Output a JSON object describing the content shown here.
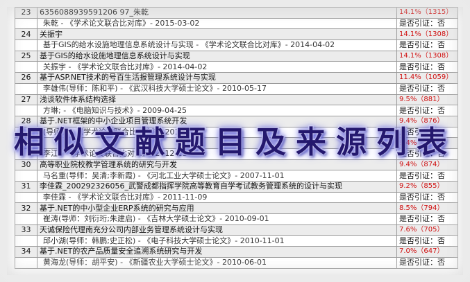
{
  "banner": {
    "text": "相似文献题目及来源列表"
  },
  "rows": [
    {
      "num": "23",
      "title": "6356088939591206 97_朱乾",
      "similarity": "14.1%（1315）",
      "source": "朱乾 - 《学术论文联合比对库》- 2015-03-02",
      "cite": "是否引证：否"
    },
    {
      "num": "24",
      "title": "关振宇",
      "similarity": "14.1%（1308）",
      "source": "基于GIS的给水设施地理信息系统设计与实现 - 《学术论文联合比对库》- 2014-04-02",
      "cite": "是否引证：否"
    },
    {
      "num": "25",
      "title": "基于GIS的给水设施地理信息系统设计与实现",
      "similarity": "14.1%（1308）",
      "source": "关振宇 - 《学术论文联合比对库》- 2014-04-02",
      "cite": "是否引证：否"
    },
    {
      "num": "26",
      "title": "基于ASP.NET技术的号百生活报管理系统设计与实现",
      "similarity": "11.4%（1059）",
      "source": "李雄伟(导师：陈和平) - 《武汉科技大学硕士论文》- 2010-05-17",
      "cite": "是否引证：否"
    },
    {
      "num": "27",
      "title": "浅谈软件体系结构选择",
      "similarity": "9.5%（881）",
      "source": "方琳; - 《电脑知识与技术》- 2009-04-25",
      "cite": "是否引证：否"
    },
    {
      "num": "28",
      "title": "基于.NET框架的中小企业项目管理系统开发",
      "similarity": "9.4%（876）",
      "source": "(导师：) - 《学术论文联合比对库》- 2015-",
      "cite": "是否引证：否"
    },
    {
      "num": "29",
      "title": "",
      "similarity": "9.4%（876）",
      "source": "李江 - 《学术论文联合比对库》- 2012-11-12",
      "cite": "是否引证：否"
    },
    {
      "num": "30",
      "title": "高等职业院校教学管理系统的研究与开发",
      "similarity": "9.4%（874）",
      "source": "马名重(导师：吴清;李新霞) - 《河北工业大学硕士论文》- 2007-11-01",
      "cite": "是否引证：否"
    },
    {
      "num": "31",
      "title": "李佳霖_200292326056_武警成都指挥学院高等教育自学考试教务管理系统的设计与实现",
      "similarity": "9.2%（855）",
      "source": "李佳霖 - 《学术论文联合比对库》- 2011-11-09",
      "cite": "是否引证：否"
    },
    {
      "num": "32",
      "title": "基于.NET的中小型企业ERP系统的研究与应用",
      "similarity": "8.5%（794）",
      "source": "崔涛(导师：刘衍珩;朱建启) - 《吉林大学硕士论文》- 2010-09-01",
      "cite": "是否引证：否"
    },
    {
      "num": "33",
      "title": "天诚保险代理南充分公司内部业务管理系统设计与实现",
      "similarity": "7.6%（705）",
      "source": "邱小湖(导师：韩鹏;史正松) - 《电子科技大学硕士论文》- 2010-11-01",
      "cite": "是否引证：否"
    },
    {
      "num": "34",
      "title": "基于.NET的农产品质量安全追溯系统研究与开发",
      "similarity": "7.0%（647）",
      "source": "黄海龙(导师：胡平安) - 《新疆农业大学硕士论文》- 2010-06-01",
      "cite": "是否引证：否"
    }
  ]
}
